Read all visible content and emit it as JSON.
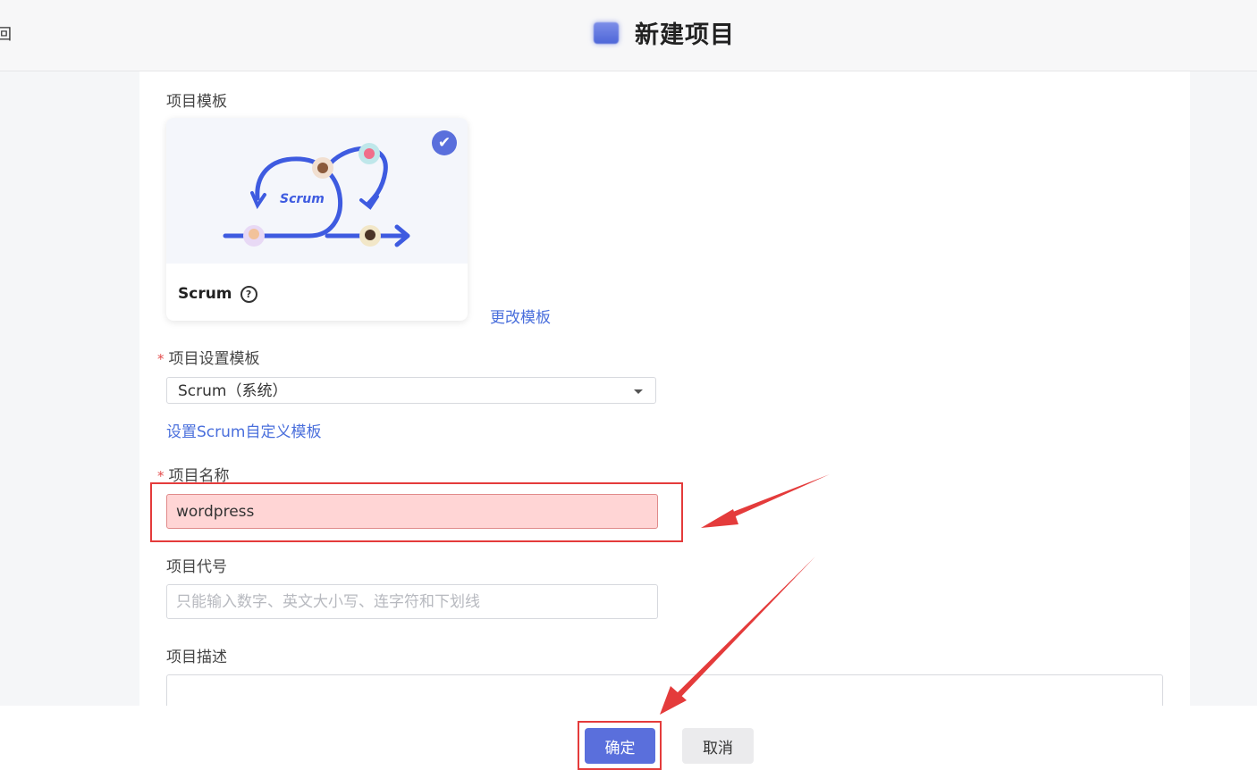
{
  "header": {
    "back_label": "回",
    "title": "新建项目"
  },
  "template_section": {
    "label": "项目模板",
    "card_name": "Scrum",
    "illustration_text": "Scrum",
    "change_link": "更改模板"
  },
  "settings_template": {
    "label": "项目设置模板",
    "selected": "Scrum（系统）",
    "custom_link": "设置Scrum自定义模板"
  },
  "project_name": {
    "label": "项目名称",
    "value": "wordpress"
  },
  "project_code": {
    "label": "项目代号",
    "placeholder": "只能输入数字、英文大小写、连字符和下划线"
  },
  "project_desc": {
    "label": "项目描述"
  },
  "footer": {
    "ok_label": "确定",
    "cancel_label": "取消"
  },
  "colors": {
    "accent": "#5a6fdc",
    "annotation": "#e43b3b",
    "required": "#e34b4b"
  }
}
